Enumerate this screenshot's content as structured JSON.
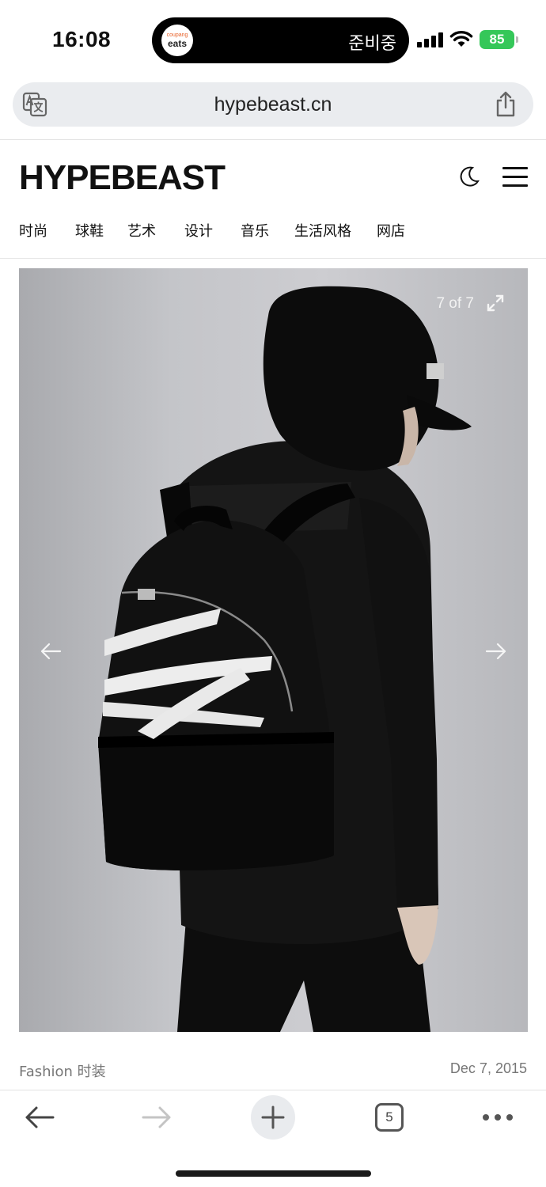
{
  "status_bar": {
    "time": "16:08",
    "island_app_small": "coupang",
    "island_app_big": "eats",
    "island_status": "준비중",
    "battery": "85"
  },
  "browser": {
    "url": "hypebeast.cn",
    "open_tabs": "5"
  },
  "site": {
    "logo": "HYPEBEAST",
    "nav": [
      "时尚",
      "球鞋",
      "艺术",
      "设计",
      "音乐",
      "生活风格",
      "网店"
    ]
  },
  "gallery": {
    "counter": "7 of 7"
  },
  "article": {
    "category": "Fashion 时装",
    "date": "Dec 7, 2015"
  },
  "icons": {
    "translate": "translate-icon",
    "share": "share-icon",
    "moon": "moon-icon",
    "menu": "hamburger-menu-icon",
    "expand": "expand-icon",
    "prev": "arrow-left-icon",
    "next": "arrow-right-icon",
    "back": "back-arrow-icon",
    "forward": "forward-arrow-icon",
    "new_tab": "plus-icon",
    "more": "more-dots-icon"
  },
  "colors": {
    "battery": "#35c759",
    "url_bar_bg": "#eaecef",
    "muted_text": "#777777"
  }
}
